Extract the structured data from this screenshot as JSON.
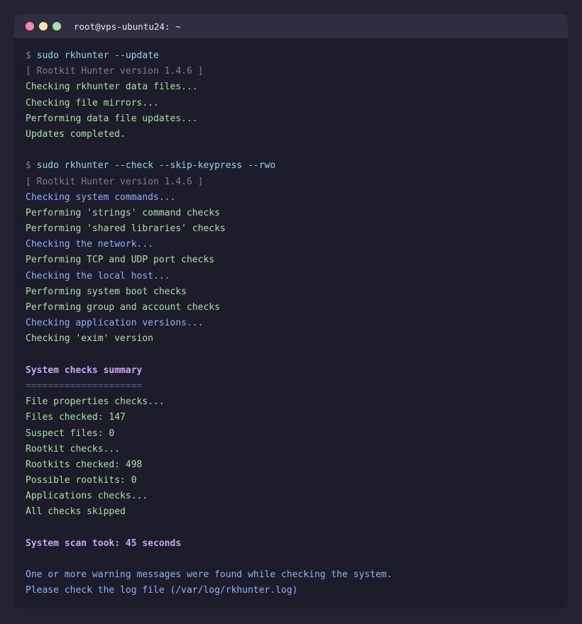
{
  "window": {
    "title": "root@vps-ubuntu24: ~",
    "buttons": {
      "close_color": "#f38ba8",
      "minimize_color": "#f9e2af",
      "maximize_color": "#a6e3a1"
    }
  },
  "terminal": {
    "prompt_symbol": "$",
    "lines": [
      {
        "type": "command",
        "text": "sudo rkhunter --update"
      },
      {
        "type": "gray",
        "text": "[ Rootkit Hunter version 1.4.6 ]"
      },
      {
        "type": "green",
        "text": "Checking rkhunter data files..."
      },
      {
        "type": "green",
        "text": "Checking file mirrors..."
      },
      {
        "type": "green",
        "text": "Performing data file updates..."
      },
      {
        "type": "green",
        "text": "Updates completed."
      },
      {
        "type": "blank",
        "text": ""
      },
      {
        "type": "command",
        "text": "sudo rkhunter --check --skip-keypress --rwo"
      },
      {
        "type": "gray",
        "text": "[ Rootkit Hunter version 1.4.6 ]"
      },
      {
        "type": "blue",
        "text": "Checking system commands..."
      },
      {
        "type": "green",
        "text": "Performing 'strings' command checks"
      },
      {
        "type": "green",
        "text": "Performing 'shared libraries' checks"
      },
      {
        "type": "blue",
        "text": "Checking the network..."
      },
      {
        "type": "green",
        "text": "Performing TCP and UDP port checks"
      },
      {
        "type": "blue",
        "text": "Checking the local host..."
      },
      {
        "type": "green",
        "text": "Performing system boot checks"
      },
      {
        "type": "green",
        "text": "Performing group and account checks"
      },
      {
        "type": "blue",
        "text": "Checking application versions..."
      },
      {
        "type": "green",
        "text": "Checking 'exim' version"
      },
      {
        "type": "blank",
        "text": ""
      },
      {
        "type": "purple",
        "text": "System checks summary"
      },
      {
        "type": "rule",
        "text": "====================="
      },
      {
        "type": "green",
        "text": "File properties checks..."
      },
      {
        "type": "green",
        "text": "Files checked: 147"
      },
      {
        "type": "green",
        "text": "Suspect files: 0"
      },
      {
        "type": "green",
        "text": "Rootkit checks..."
      },
      {
        "type": "green",
        "text": "Rootkits checked: 498"
      },
      {
        "type": "green",
        "text": "Possible rootkits: 0"
      },
      {
        "type": "green",
        "text": "Applications checks..."
      },
      {
        "type": "green",
        "text": "All checks skipped"
      },
      {
        "type": "blank",
        "text": ""
      },
      {
        "type": "purple",
        "text": "System scan took: 45 seconds"
      },
      {
        "type": "blank",
        "text": ""
      },
      {
        "type": "blue",
        "text": "One or more warning messages were found while checking the system."
      },
      {
        "type": "blue",
        "text": "Please check the log file (/var/log/rkhunter.log)"
      }
    ]
  },
  "colors": {
    "background": "#232333",
    "window": "#1c1c2a",
    "titlebar": "#2e2e40",
    "command": "#89dceb",
    "gray": "#7c7f93",
    "green": "#a6e3a1",
    "blue": "#89b4fa",
    "purple": "#cba6f7"
  }
}
